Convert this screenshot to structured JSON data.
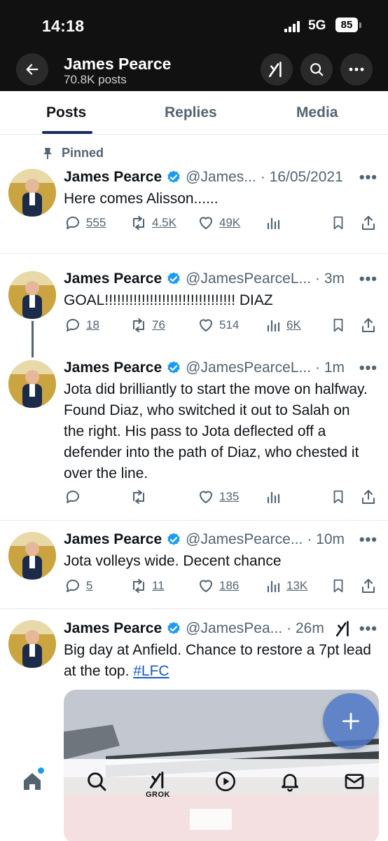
{
  "status": {
    "time": "14:18",
    "network": "5G",
    "battery": "85"
  },
  "header": {
    "name": "James Pearce",
    "post_count": "70.8K posts"
  },
  "tabs": [
    {
      "label": "Posts",
      "active": true
    },
    {
      "label": "Replies",
      "active": false
    },
    {
      "label": "Media",
      "active": false
    }
  ],
  "pinned_label": "Pinned",
  "posts": [
    {
      "author": "James Pearce",
      "handle": "@James...",
      "time": "· 16/05/2021",
      "text": "Here comes Alisson......",
      "replies": "555",
      "reposts": "4.5K",
      "likes": "49K",
      "views": ""
    },
    {
      "author": "James Pearce",
      "handle": "@JamesPearceL...",
      "time": "· 3m",
      "text": "GOAL!!!!!!!!!!!!!!!!!!!!!!!!!!!!!!!! DIAZ",
      "replies": "18",
      "reposts": "76",
      "likes": "514",
      "views": "6K"
    },
    {
      "author": "James Pearce",
      "handle": "@JamesPearceL...",
      "time": "· 1m",
      "text": "Jota did brilliantly to start the move on halfway. Found Diaz, who switched it out to Salah on the right. His pass to Jota deflected off a defender into the path of Diaz, who chested it over the line.",
      "replies": "",
      "reposts": "",
      "likes": "135",
      "views": ""
    },
    {
      "author": "James Pearce",
      "handle": "@JamesPearce...",
      "time": "· 10m",
      "text": "Jota volleys wide. Decent chance",
      "replies": "5",
      "reposts": "11",
      "likes": "186",
      "views": "13K"
    },
    {
      "author": "James Pearce",
      "handle": "@JamesPea...",
      "time": "· 26m",
      "text": "Big day at Anfield. Chance to restore a 7pt lead at the top.",
      "hashtag": "#LFC"
    }
  ],
  "bottom_nav": {
    "grok_label": "GROK"
  },
  "colors": {
    "header_bg": "#111111",
    "accent": "#1d9bf0",
    "muted": "#536471",
    "verified": "#1d9bf0"
  }
}
